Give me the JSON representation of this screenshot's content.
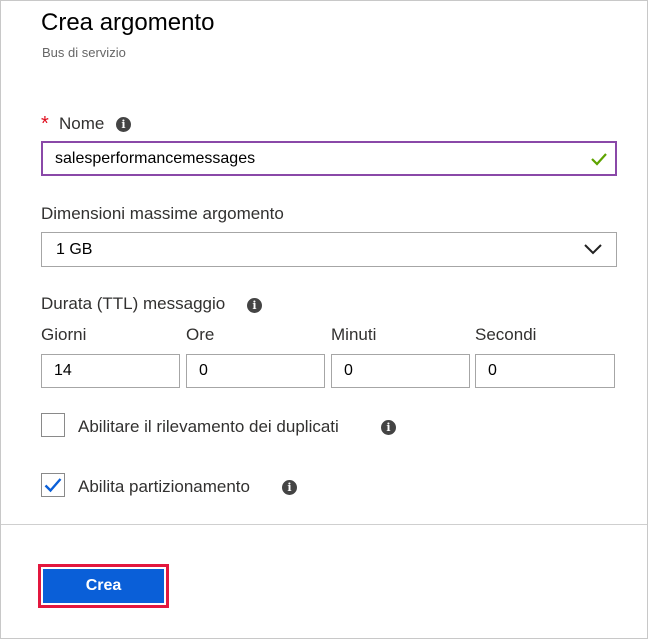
{
  "header": {
    "title": "Crea argomento",
    "subtitle": "Bus di servizio"
  },
  "form": {
    "name": {
      "required_mark": "*",
      "label": "Nome",
      "value": "salesperformancemessages",
      "valid": true
    },
    "max_size": {
      "label": "Dimensioni massime argomento",
      "selected": "1 GB"
    },
    "ttl": {
      "label": "Durata (TTL) messaggio",
      "fields": [
        {
          "label": "Giorni",
          "value": "14"
        },
        {
          "label": "Ore",
          "value": "0"
        },
        {
          "label": "Minuti",
          "value": "0"
        },
        {
          "label": "Secondi",
          "value": "0"
        }
      ]
    },
    "duplicate_detection": {
      "label": "Abilitare il rilevamento dei duplicati",
      "checked": false
    },
    "partitioning": {
      "label": "Abilita partizionamento",
      "checked": true
    }
  },
  "footer": {
    "create_label": "Crea"
  },
  "colors": {
    "primary": "#0a5fd8",
    "required": "#e00b1c",
    "valid_border": "#8a48a8",
    "valid_check": "#5ea300",
    "highlight": "#e3173e"
  }
}
